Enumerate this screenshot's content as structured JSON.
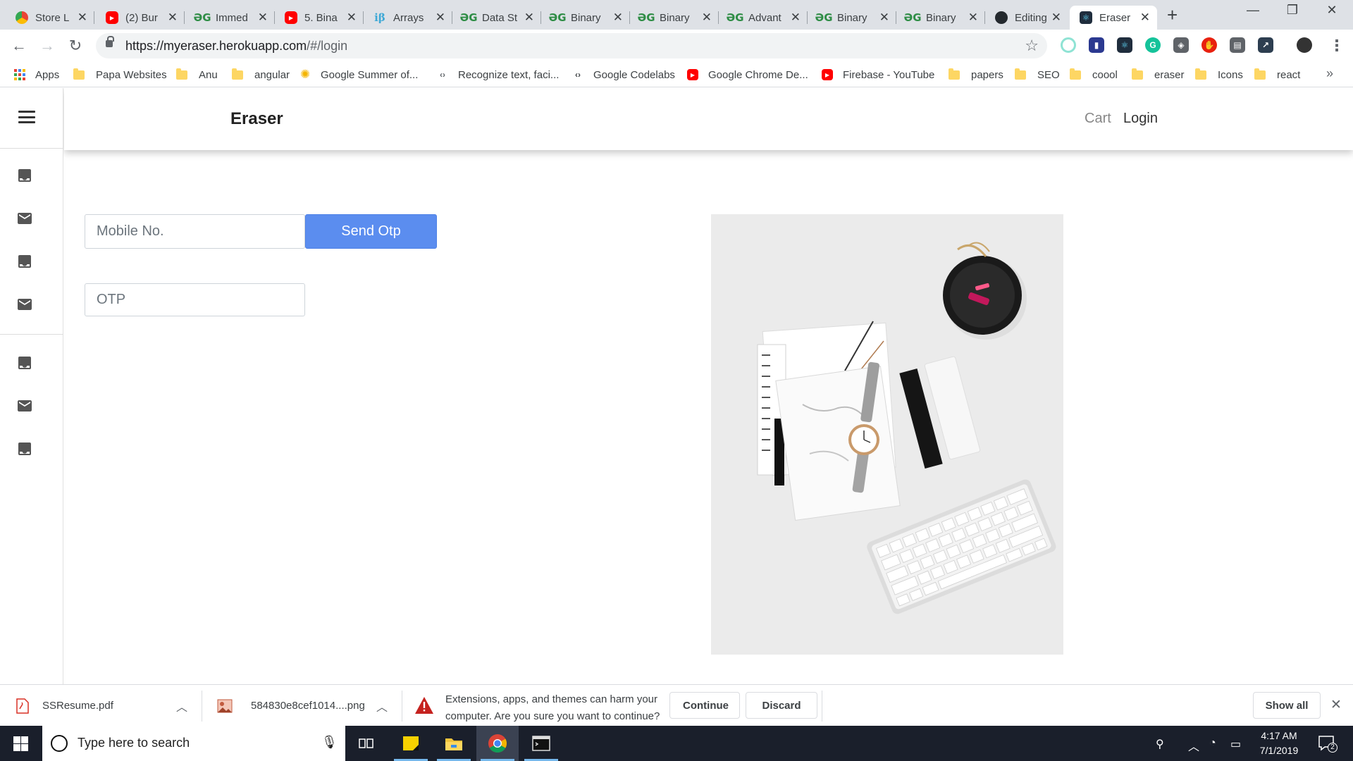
{
  "browser": {
    "tabs": [
      {
        "title": "Store L",
        "icon": "chrome-store-icon"
      },
      {
        "title": "(2) Bur",
        "icon": "youtube-icon"
      },
      {
        "title": "Immed",
        "icon": "gfg-icon"
      },
      {
        "title": "5. Bina",
        "icon": "youtube-icon"
      },
      {
        "title": "Arrays",
        "icon": "interviewbit-icon"
      },
      {
        "title": "Data St",
        "icon": "gfg-icon"
      },
      {
        "title": "Binary",
        "icon": "gfg-icon"
      },
      {
        "title": "Binary",
        "icon": "gfg-icon"
      },
      {
        "title": "Advant",
        "icon": "gfg-icon"
      },
      {
        "title": "Binary",
        "icon": "gfg-icon"
      },
      {
        "title": "Binary",
        "icon": "gfg-icon"
      },
      {
        "title": "Editing",
        "icon": "github-icon"
      },
      {
        "title": "Eraser",
        "icon": "react-icon",
        "active": true
      }
    ],
    "url_host": "https://myeraser.herokuapp.com",
    "url_path": "/#/login",
    "bookmarks": [
      "Apps",
      "Papa Websites",
      "Anu",
      "angular",
      "Google Summer of...",
      "Recognize text, faci...",
      "Google Codelabs",
      "Google Chrome De...",
      "Firebase - YouTube",
      "papers",
      "SEO",
      "coool",
      "eraser",
      "Icons",
      "react"
    ]
  },
  "app": {
    "brand": "Eraser",
    "nav": {
      "cart": "Cart",
      "login": "Login"
    },
    "form": {
      "mobile_placeholder": "Mobile No.",
      "otp_placeholder": "OTP",
      "send_button": "Send Otp"
    },
    "sidebar_icons": [
      "download-box-icon",
      "mail-icon",
      "download-box-icon",
      "mail-icon",
      "download-box-icon",
      "mail-icon",
      "download-box-icon"
    ]
  },
  "downloads": {
    "items": [
      "SSResume.pdf",
      "584830e8cef1014....png"
    ],
    "warning_line1": "Extensions, apps, and themes can harm your",
    "warning_line2": "computer. Are you sure you want to continue?",
    "continue": "Continue",
    "discard": "Discard",
    "show_all": "Show all"
  },
  "taskbar": {
    "search_placeholder": "Type here to search",
    "time": "4:17 AM",
    "date": "7/1/2019",
    "notification_count": "2"
  },
  "colors": {
    "accent_button": "#5b8def",
    "chrome_frame": "#dee1e6",
    "taskbar": "#1a1f2b"
  }
}
